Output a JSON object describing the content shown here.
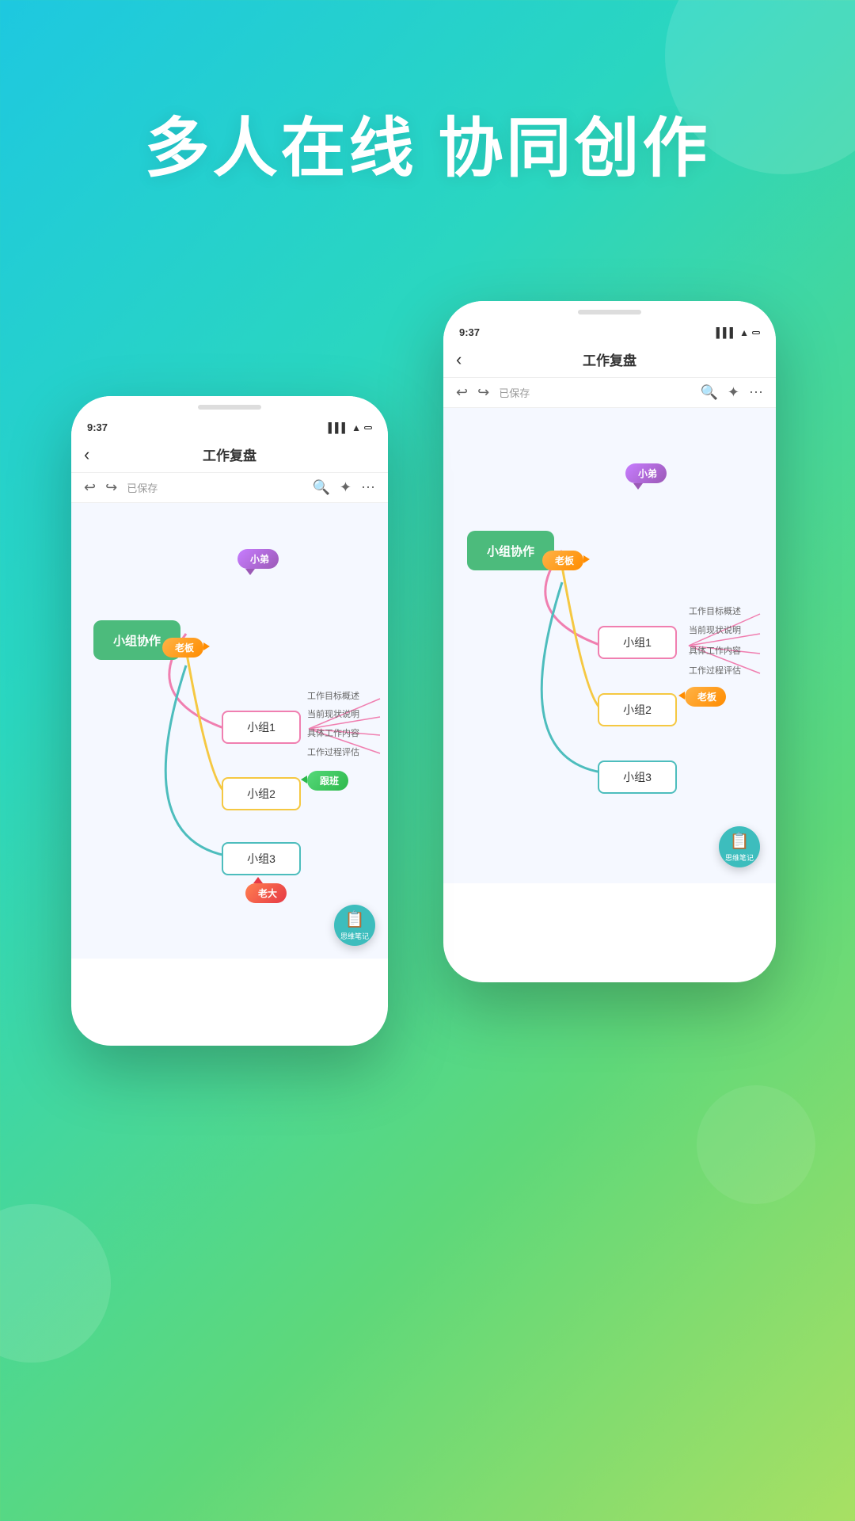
{
  "hero": {
    "title": "多人在线 协同创作"
  },
  "phone_back": {
    "time": "9:37",
    "header_title": "工作复盘",
    "back_label": "‹",
    "saved_label": "已保存",
    "center_node": "小组协作",
    "nodes": [
      {
        "id": "n1",
        "label": "小组1",
        "type": "pink"
      },
      {
        "id": "n2",
        "label": "小组2",
        "type": "yellow"
      },
      {
        "id": "n3",
        "label": "小组3",
        "type": "teal"
      }
    ],
    "branches": [
      "工作目标概述",
      "当前现状说明",
      "具体工作内容",
      "工作过程评估"
    ],
    "avatars": [
      {
        "label": "老板",
        "type": "orange"
      },
      {
        "label": "老板",
        "type": "orange"
      }
    ],
    "note_label": "思维笔记"
  },
  "phone_front": {
    "time": "9:37",
    "header_title": "工作复盘",
    "back_label": "‹",
    "saved_label": "已保存",
    "center_node": "小组协作",
    "nodes": [
      {
        "id": "n1",
        "label": "小组1",
        "type": "pink"
      },
      {
        "id": "n2",
        "label": "小组2",
        "type": "yellow"
      },
      {
        "id": "n3",
        "label": "小组3",
        "type": "teal"
      }
    ],
    "branches": [
      "工作目标概述",
      "当前现状说明",
      "具体工作内容",
      "工作过程评估"
    ],
    "avatars": [
      {
        "label": "老板",
        "type": "orange"
      },
      {
        "label": "跟班",
        "type": "green"
      },
      {
        "label": "老大",
        "type": "red-orange"
      },
      {
        "label": "小弟",
        "type": "purple"
      }
    ],
    "note_label": "思维笔记"
  },
  "icons": {
    "back": "‹",
    "undo": "↩",
    "redo": "↪",
    "search": "🔍",
    "share": "✦",
    "more": "⋯",
    "note": "📋"
  }
}
